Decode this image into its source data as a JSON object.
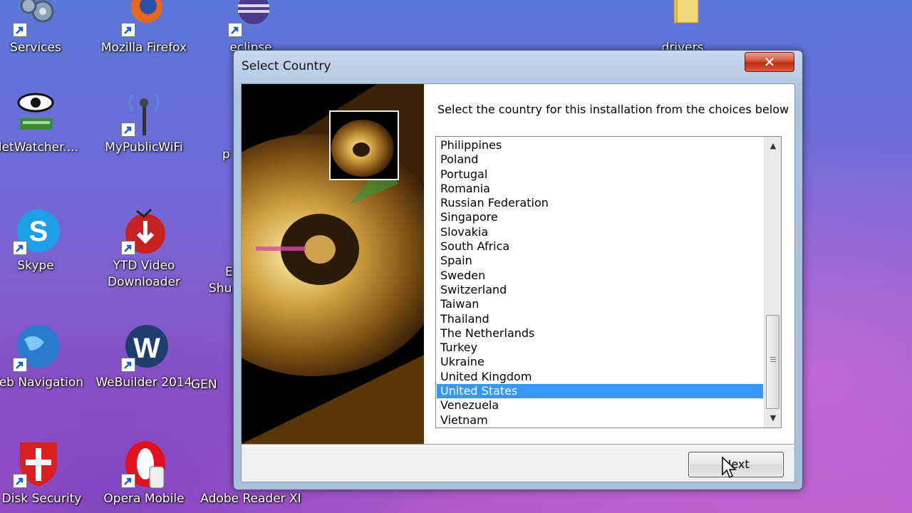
{
  "desktop": {
    "icons": [
      {
        "label": "Services"
      },
      {
        "label": "Mozilla Firefox"
      },
      {
        "label": "eclipse"
      },
      {
        "label": "drivers"
      },
      {
        "label": "NetWatcher...."
      },
      {
        "label": "MyPublicWiFi"
      },
      {
        "label": "Skype"
      },
      {
        "label": "YTD Video\nDownloader"
      },
      {
        "label": "Web Navigation"
      },
      {
        "label": "WeBuilder 2014"
      },
      {
        "label": "GEN"
      },
      {
        "label": "B Disk Security"
      },
      {
        "label": "Opera Mobile"
      },
      {
        "label": "Adobe Reader XI"
      },
      {
        "label": "E"
      },
      {
        "label": "Shu"
      },
      {
        "label": "p"
      }
    ]
  },
  "dialog": {
    "title": "Select Country",
    "close_label": "✕",
    "instruction": "Select the country for this installation from the choices below",
    "countries": [
      "Philippines",
      "Poland",
      "Portugal",
      "Romania",
      "Russian Federation",
      "Singapore",
      "Slovakia",
      "South Africa",
      "Spain",
      "Sweden",
      "Switzerland",
      "Taiwan",
      "Thailand",
      "The Netherlands",
      "Turkey",
      "Ukraine",
      "United Kingdom",
      "United States",
      "Venezuela",
      "Vietnam"
    ],
    "selected": "United States",
    "next_label": "Next"
  },
  "colors": {
    "selection": "#3399ff",
    "close_button": "#c9401f"
  }
}
